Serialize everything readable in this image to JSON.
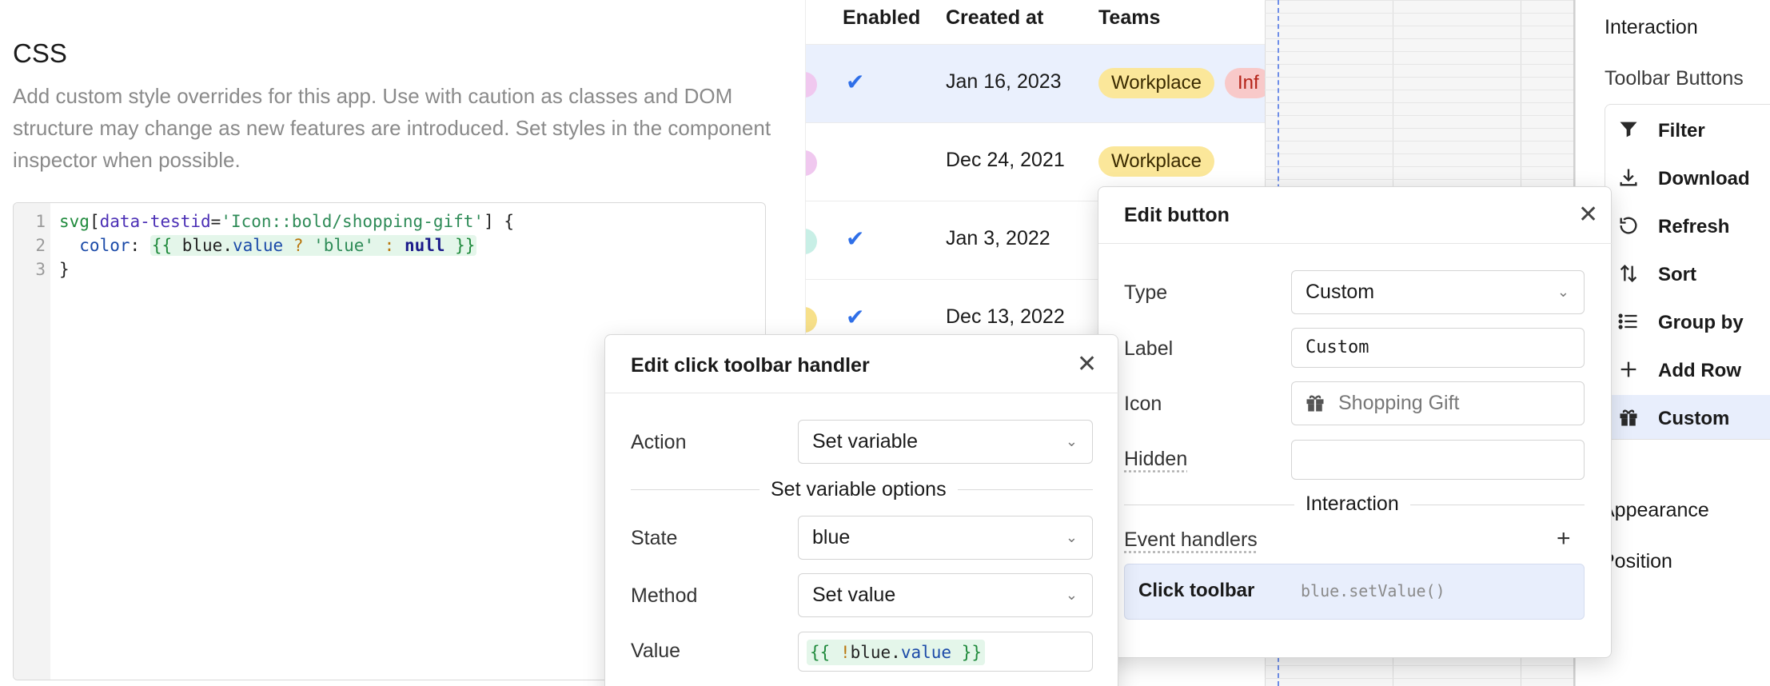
{
  "css_panel": {
    "title": "CSS",
    "description": "Add custom style overrides for this app. Use with caution as classes and DOM structure may change as new features are introduced. Set styles in the component inspector when possible.",
    "line_numbers": [
      "1",
      "2",
      "3"
    ],
    "code": {
      "l1_tag": "svg",
      "l1_bracket_open": "[",
      "l1_attr": "data-testid",
      "l1_eq": "=",
      "l1_str": "'Icon::bold/shopping-gift'",
      "l1_rest": "] {",
      "l2_prop": "  color",
      "l2_colon": ": ",
      "l2_tpl_open": "{{ ",
      "l2_var": "blue",
      "l2_dot": ".",
      "l2_field": "value",
      "l2_q": " ? ",
      "l2_str": "'blue'",
      "l2_c": " : ",
      "l2_null": "null",
      "l2_tpl_close": " }}",
      "l3": "}"
    }
  },
  "table": {
    "headers": {
      "enabled": "Enabled",
      "created_at": "Created at",
      "teams": "Teams"
    },
    "rows": [
      {
        "enabled": true,
        "check": "✔",
        "created": "Jan 16, 2023",
        "teams": [
          "Workplace",
          "Inf"
        ],
        "avatar_color": "#f0c8ef",
        "selected": true
      },
      {
        "enabled": false,
        "check": "",
        "created": "Dec 24, 2021",
        "teams": [
          "Workplace"
        ],
        "avatar_color": "#f0c8ef",
        "selected": false
      },
      {
        "enabled": true,
        "check": "✔",
        "created": "Jan 3, 2022",
        "teams": [],
        "avatar_color": "#c8efe6",
        "selected": false
      },
      {
        "enabled": true,
        "check": "✔",
        "created": "Dec 13, 2022",
        "teams": [],
        "avatar_color": "#f7e08a",
        "selected": false
      }
    ]
  },
  "inspector": {
    "interaction_heading": "Interaction",
    "toolbar_heading": "Toolbar Buttons",
    "toolbar_items": [
      {
        "label": "Filter",
        "icon": "filter-icon",
        "selected": false
      },
      {
        "label": "Download",
        "icon": "download-icon",
        "selected": false
      },
      {
        "label": "Refresh",
        "icon": "refresh-icon",
        "selected": false
      },
      {
        "label": "Sort",
        "icon": "sort-icon",
        "selected": false
      },
      {
        "label": "Group by",
        "icon": "list-icon",
        "selected": false
      },
      {
        "label": "Add Row",
        "icon": "plus-icon",
        "selected": false
      },
      {
        "label": "Custom",
        "icon": "shopping-gift-icon",
        "selected": true
      }
    ],
    "appearance_heading": "Appearance",
    "position_heading": "Position"
  },
  "edit_button_modal": {
    "title": "Edit button",
    "close": "✕",
    "type_label": "Type",
    "type_value": "Custom",
    "label_label": "Label",
    "label_value": "Custom",
    "icon_label": "Icon",
    "icon_value": "Shopping Gift",
    "hidden_label": "Hidden",
    "hidden_value": "",
    "section": "Interaction",
    "event_handlers_label": "Event handlers",
    "add": "+",
    "handler_name": "Click toolbar",
    "handler_code": "blue.setValue()"
  },
  "click_handler_modal": {
    "title": "Edit click toolbar handler",
    "close": "✕",
    "action_label": "Action",
    "action_value": "Set variable",
    "section": "Set variable options",
    "state_label": "State",
    "state_value": "blue",
    "method_label": "Method",
    "method_value": "Set value",
    "value_label": "Value",
    "value_tpl_open": "{{ ",
    "value_bang": "!",
    "value_var": "blue",
    "value_dot": ".",
    "value_field": "value",
    "value_tpl_close": " }}"
  },
  "colors": {
    "accent": "#2f6fe8",
    "selected_row": "#eaf0fd",
    "team_pill": "#fbe79a",
    "team_pill_alt": "#f8c9c9"
  }
}
